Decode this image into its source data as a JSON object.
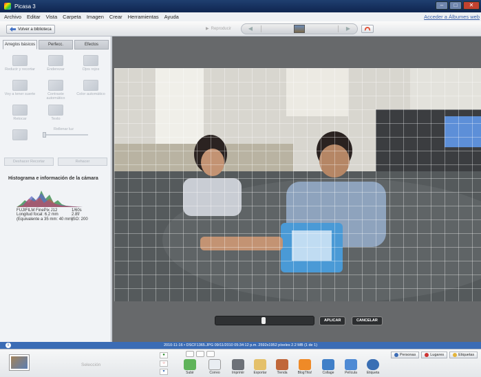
{
  "window": {
    "title": "Picasa 3"
  },
  "menu": {
    "items": [
      "Archivo",
      "Editar",
      "Vista",
      "Carpeta",
      "Imagen",
      "Crear",
      "Herramientas",
      "Ayuda"
    ],
    "account_link": "Acceder a Álbumes web"
  },
  "toolbar": {
    "back_label": "Volver a biblioteca",
    "play_label": "Reproducir"
  },
  "left_panel": {
    "tabs": [
      "Arreglos básicos",
      "Perfecc.",
      "Efectos"
    ],
    "tools": [
      "Reducir y recortar",
      "Enderezar",
      "Ojos rojos",
      "Voy a tener suerte",
      "Contraste automático",
      "Color automático",
      "Retocar",
      "Texto",
      "Rellenar luz"
    ],
    "slider_label": "Rellenar luz",
    "undo_label": "Deshacer Recortar",
    "redo_label": "Rehacer",
    "histogram_title": "Histograma e información de la cámara",
    "camera_info": {
      "model": "FUJIFILM FinePix J12",
      "focal": "Longitud focal: 6.2 mm",
      "equiv": "(Equivalente a 35 mm: 40 mm)",
      "exposure": "1/60s",
      "aperture": "2.8f/",
      "iso": "ISO: 200"
    }
  },
  "viewer": {
    "apply_label": "APLICAR",
    "cancel_label": "CANCELAR"
  },
  "status": {
    "text": "2010-11-16 • DSCF1365.JPG   09/11/2010 05:34:12 p.m.   2592x1952 píxeles   2.2 MB   (1 de 1)"
  },
  "tray": {
    "selection_label": "Selección",
    "actions": [
      "Subir",
      "Correo",
      "Imprimir",
      "Exportar",
      "Tienda",
      "BlogThis!",
      "Collage",
      "Película",
      "Etiqueta"
    ],
    "tag_buttons": [
      "Personas",
      "Lugares",
      "Etiquetas"
    ]
  }
}
